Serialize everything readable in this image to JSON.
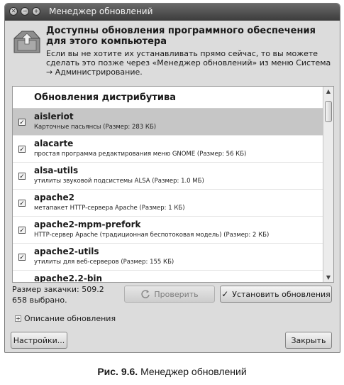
{
  "window": {
    "title": "Менеджер обновлений",
    "controls": [
      "✕",
      "−",
      "+"
    ]
  },
  "header": {
    "title": "Доступны обновления программного обеспечения для этого компьютера",
    "text": "Если вы не хотите их устанавливать прямо сейчас, то вы можете сделать это позже через «Менеджер обновлений» из меню Система → Администрирование."
  },
  "list": {
    "section_title": "Обновления дистрибутива",
    "items": [
      {
        "name": "aisleriot",
        "desc": "Карточные пасьянсы (Размер: 283 КБ)",
        "checked": true,
        "selected": true
      },
      {
        "name": "alacarte",
        "desc": "простая программа редактирования меню GNOME (Размер: 56 КБ)",
        "checked": true,
        "selected": false
      },
      {
        "name": "alsa-utils",
        "desc": "утилиты звуковой подсистемы ALSA (Размер: 1.0 МБ)",
        "checked": true,
        "selected": false
      },
      {
        "name": "apache2",
        "desc": "метапакет HTTP-сервера Apache (Размер: 1 КБ)",
        "checked": true,
        "selected": false
      },
      {
        "name": "apache2-mpm-prefork",
        "desc": "HTTP-сервер Apache (традиционная беспотоковая модель) (Размер: 2 КБ)",
        "checked": true,
        "selected": false
      },
      {
        "name": "apache2-utils",
        "desc": "утилиты для веб-серверов (Размер: 155 КБ)",
        "checked": true,
        "selected": false
      },
      {
        "name": "apache2.2-bin",
        "desc": "",
        "checked": true,
        "selected": false
      }
    ]
  },
  "status": {
    "download_size": "Размер закачки: 509.2",
    "selected_count": "658 выбрано."
  },
  "buttons": {
    "check": "Проверить",
    "install": "Установить обновления",
    "settings": "Настройки...",
    "close": "Закрыть"
  },
  "expander": {
    "label": "Описание обновления"
  },
  "caption": {
    "figure": "Рис. 9.6.",
    "text": "Менеджер обновлений"
  },
  "icons": {
    "titlebar_close": "close-icon",
    "titlebar_minimize": "minimize-icon",
    "titlebar_maximize": "maximize-icon",
    "header": "software-update-icon",
    "check": "refresh-icon",
    "install": "checkmark-icon",
    "expander": "plus-icon"
  }
}
